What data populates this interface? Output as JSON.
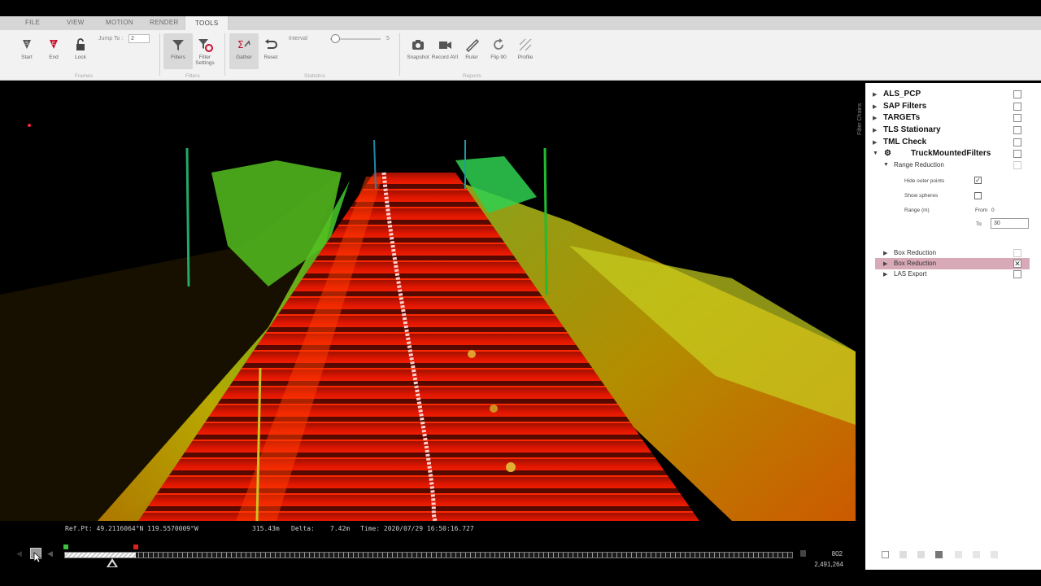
{
  "menu": {
    "tabs": [
      "FILE",
      "VIEW",
      "MOTION",
      "RENDER",
      "TOOLS"
    ],
    "active_tab": "TOOLS"
  },
  "ribbon": {
    "start": "Start",
    "end": "End",
    "lock": "Lock",
    "jump_to_label": "Jump To :",
    "jump_to_value": "2",
    "filters": "Filters",
    "filter_settings": "Filter Settings",
    "gather": "Gather",
    "reset": "Reset",
    "interval_label": "Interval",
    "interval_value": "5",
    "snapshot": "Snapshot",
    "record_avi": "Record AVI",
    "ruler": "Ruler",
    "flip90": "Flip 90",
    "profile": "Profile",
    "groups": [
      "Frames",
      "Filters",
      "Statistics",
      "Reports"
    ]
  },
  "side_tab": "Filter Chains",
  "panel": {
    "chains": [
      "ALS_PCP",
      "SAP Filters",
      "TARGETs",
      "TLS Stationary",
      "TML Check",
      "TruckMountedFilters"
    ],
    "range_reduction": "Range Reduction",
    "hide_outer_points": "Hide outer points",
    "show_spheres": "Show spheres",
    "range_label": "Range (m)",
    "from_label": "From",
    "from_value": "0",
    "to_label": "To",
    "to_value": "30",
    "box_reduction_1": "Box Reduction",
    "box_reduction_2": "Box Reduction",
    "las_export": "LAS Export"
  },
  "status": {
    "ref_pt": "Ref.Pt:  49.2116064°N  119.5570009°W",
    "distance": "315.43m",
    "delta_label": "Delta:",
    "delta": "7.42m",
    "time": "Time: 2020/07/29 16:50:16.727"
  },
  "timeline": {
    "frames": "802",
    "points": "2,491,264",
    "progress": 0.097
  },
  "colors": {
    "selected_row": "#d8a9b6",
    "near_points": "#ff2a00",
    "far_points": "#33cc33"
  }
}
